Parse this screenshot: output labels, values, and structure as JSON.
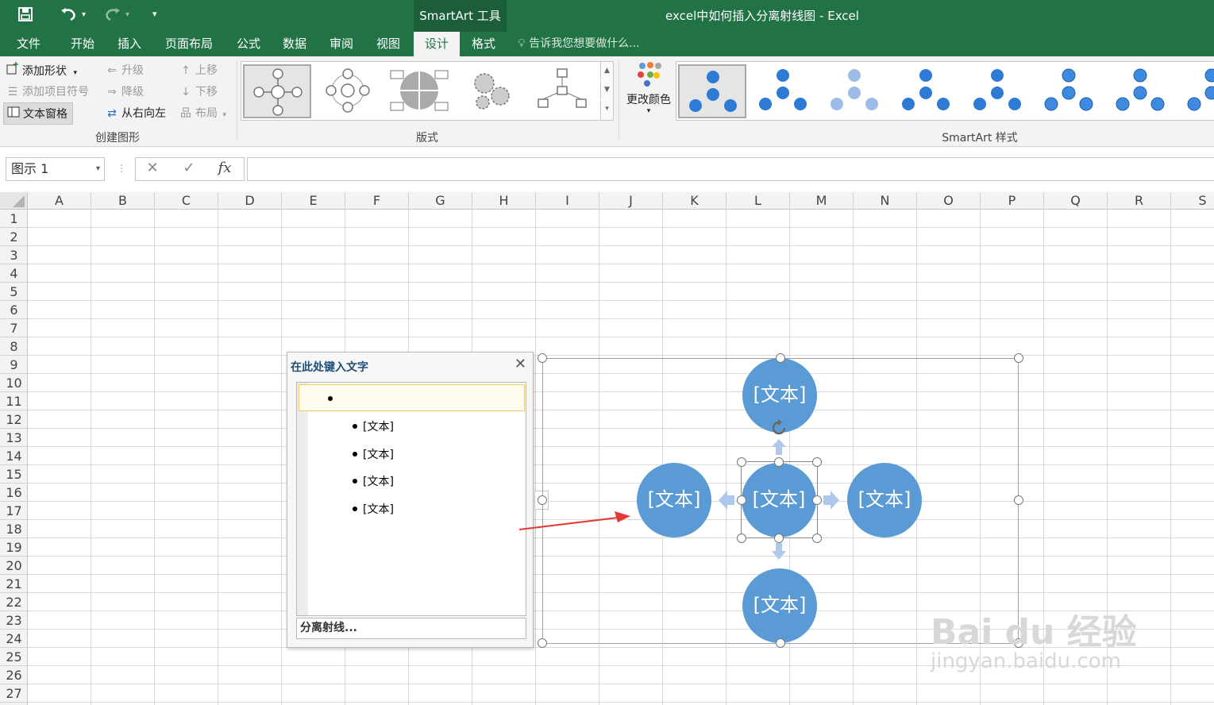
{
  "window": {
    "title": "excel中如何插入分离射线图 - Excel",
    "context_tools_label": "SmartArt 工具"
  },
  "tabs": [
    "文件",
    "开始",
    "插入",
    "页面布局",
    "公式",
    "数据",
    "审阅",
    "视图",
    "设计",
    "格式"
  ],
  "active_tab": "设计",
  "tell_me": "告诉我您想要做什么...",
  "ribbon": {
    "create_graphic": {
      "add_shape": "添加形状",
      "add_bullet": "添加项目符号",
      "text_pane": "文本窗格",
      "promote": "升级",
      "demote": "降级",
      "right_to_left": "从右向左",
      "move_up": "上移",
      "move_down": "下移",
      "layout": "布局",
      "label": "创建图形"
    },
    "layouts": {
      "label": "版式"
    },
    "change_colors": "更改颜色",
    "styles": {
      "label": "SmartArt 样式"
    }
  },
  "formula_bar": {
    "name_box": "图示 1",
    "fx": "fx",
    "content": ""
  },
  "columns": [
    "A",
    "B",
    "C",
    "D",
    "E",
    "F",
    "G",
    "H",
    "I",
    "J",
    "K",
    "L",
    "M",
    "N",
    "O",
    "P",
    "Q",
    "R",
    "S"
  ],
  "rows": [
    "1",
    "2",
    "3",
    "4",
    "5",
    "6",
    "7",
    "8",
    "9",
    "10",
    "11",
    "12",
    "13",
    "14",
    "15",
    "16",
    "17",
    "18",
    "19",
    "20",
    "21",
    "22",
    "23",
    "24",
    "25",
    "26",
    "27"
  ],
  "text_pane": {
    "title": "在此处键入文字",
    "first_item": "",
    "items": [
      "[文本]",
      "[文本]",
      "[文本]",
      "[文本]"
    ],
    "footer": "分离射线..."
  },
  "smartart": {
    "center": "[文本]",
    "top": "[文本]",
    "left": "[文本]",
    "right": "[文本]",
    "bottom": "[文本]",
    "circle_color": "#5b9bd5",
    "arrow_color": "#adc8ea"
  },
  "annotation_arrow_color": "#e53935",
  "watermark": {
    "brand": "Bai du 经验",
    "url": "jingyan.baidu.com"
  },
  "theme": {
    "excel_green": "#217346"
  }
}
